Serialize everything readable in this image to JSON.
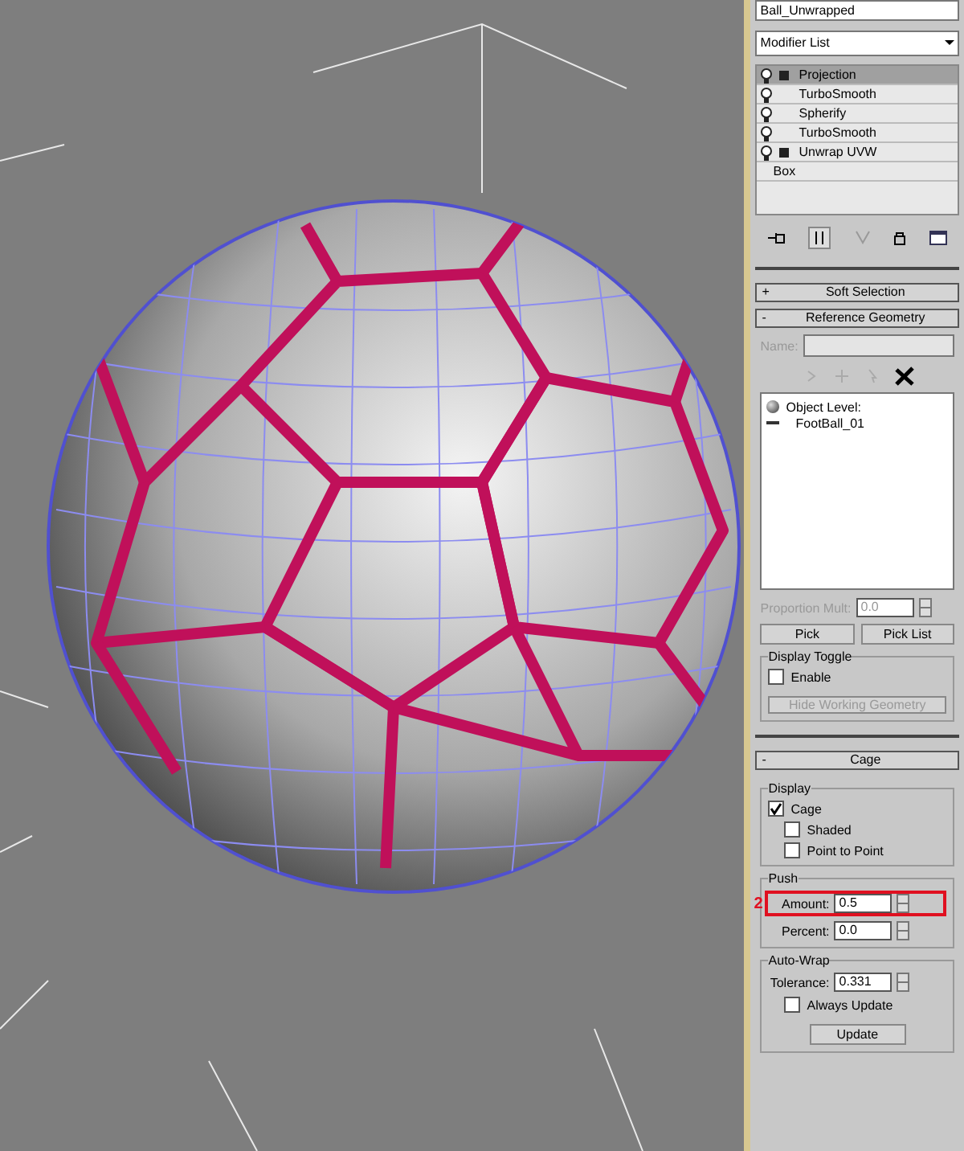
{
  "object_name": "Ball_Unwrapped",
  "modifier_list": "Modifier List",
  "stack": [
    {
      "label": "Projection",
      "kind": "modifier",
      "expandable": true,
      "selected": true
    },
    {
      "label": "TurboSmooth",
      "kind": "modifier",
      "expandable": false,
      "selected": false
    },
    {
      "label": "Spherify",
      "kind": "modifier",
      "expandable": false,
      "selected": false
    },
    {
      "label": "TurboSmooth",
      "kind": "modifier",
      "expandable": false,
      "selected": false
    },
    {
      "label": "Unwrap UVW",
      "kind": "modifier",
      "expandable": true,
      "selected": false
    },
    {
      "label": "Box",
      "kind": "base",
      "expandable": false,
      "selected": false
    }
  ],
  "soft_selection": {
    "sign": "+",
    "title": "Soft Selection"
  },
  "reference_geometry": {
    "sign": "-",
    "title": "Reference Geometry",
    "name_label": "Name:",
    "items": [
      {
        "label": "Object Level:",
        "kind": "level"
      },
      {
        "label": "FootBall_01",
        "kind": "object"
      }
    ],
    "proportion_label": "Proportion Mult:",
    "proportion_value": "0.0",
    "buttons": [
      "Pick",
      "Pick List"
    ],
    "display_toggle": {
      "title": "Display Toggle",
      "enable": {
        "label": "Enable",
        "checked": false
      },
      "button": {
        "label": "Hide Working Geometry",
        "disabled": true
      }
    }
  },
  "cage": {
    "sign": "-",
    "title": "Cage",
    "display": {
      "title": "Display",
      "options": [
        {
          "label": "Cage",
          "kind": "main",
          "checked": true
        },
        {
          "label": "Shaded",
          "kind": "sub",
          "checked": false
        },
        {
          "label": "Point to Point",
          "kind": "sub",
          "checked": false
        }
      ]
    },
    "push": {
      "title": "Push",
      "fields": [
        {
          "label": "Amount:",
          "value": "0.5",
          "marker": "2"
        },
        {
          "label": "Percent:",
          "value": "0.0"
        }
      ]
    },
    "auto_wrap": {
      "title": "Auto-Wrap",
      "tolerance": {
        "label": "Tolerance:",
        "value": "0.331"
      },
      "always_update": {
        "label": "Always Update",
        "checked": false
      },
      "button": "Update"
    }
  }
}
